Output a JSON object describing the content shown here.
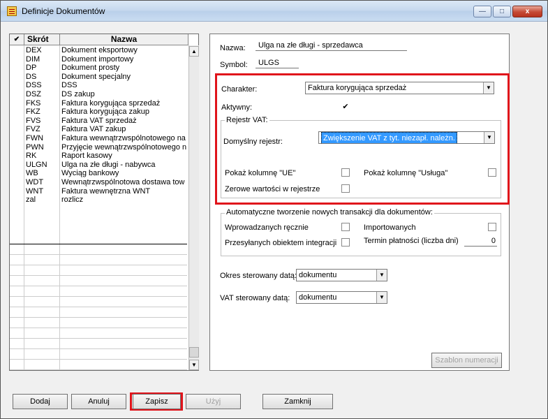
{
  "window": {
    "title": "Definicje Dokumentów",
    "controls": {
      "minimize": "—",
      "maximize": "□",
      "close": "x"
    }
  },
  "grid": {
    "headers": {
      "check": "✔",
      "code": "Skrót",
      "name": "Nazwa"
    },
    "rows": [
      {
        "code": "DEX",
        "name": "Dokument eksportowy"
      },
      {
        "code": "DIM",
        "name": "Dokument importowy"
      },
      {
        "code": "DP",
        "name": "Dokument prosty"
      },
      {
        "code": "DS",
        "name": "Dokument specjalny"
      },
      {
        "code": "DSS",
        "name": "DSS"
      },
      {
        "code": "DSZ",
        "name": "DS zakup"
      },
      {
        "code": "FKS",
        "name": "Faktura korygująca sprzedaż"
      },
      {
        "code": "FKZ",
        "name": "Faktura korygująca zakup"
      },
      {
        "code": "FVS",
        "name": "Faktura VAT sprzedaż"
      },
      {
        "code": "FVZ",
        "name": "Faktura VAT zakup"
      },
      {
        "code": "FWN",
        "name": "Faktura wewnątrzwspólnotowego na"
      },
      {
        "code": "PWN",
        "name": "Przyjęcie wewnątrzwspólnotowego n"
      },
      {
        "code": "RK",
        "name": "Raport kasowy"
      },
      {
        "code": "ULGN",
        "name": "Ulga na złe długi - nabywca"
      },
      {
        "code": "WB",
        "name": "Wyciąg bankowy"
      },
      {
        "code": "WDT",
        "name": "Wewnątrzwspólnotowa dostawa tow"
      },
      {
        "code": "WNT",
        "name": "Faktura wewnętrzna WNT"
      },
      {
        "code": "zal",
        "name": "rozlicz"
      }
    ]
  },
  "form": {
    "name_label": "Nazwa:",
    "name_value": "Ulga na złe długi - sprzedawca",
    "symbol_label": "Symbol:",
    "symbol_value": "ULGS",
    "charakter_label": "Charakter:",
    "charakter_value": "Faktura korygująca sprzedaż",
    "aktywny_label": "Aktywny:",
    "aktywny_checked": "✔",
    "rejestr_group": "Rejestr VAT:",
    "domyslny_label": "Domyślny rejestr:",
    "domyslny_value": "Zwiększenie VAT z tyt. niezapł. należn.",
    "pokaz_ue_label": "Pokaż kolumnę \"UE\"",
    "pokaz_usluga_label": "Pokaż kolumnę \"Usługa\"",
    "zerowe_label": "Zerowe wartości w rejestrze",
    "auto_group": "Automatyczne tworzenie nowych transakcji dla dokumentów:",
    "wprowadzanych_label": "Wprowadzanych ręcznie",
    "importowanych_label": "Importowanych",
    "przesylanych_label": "Przesyłanych obiektem integracji",
    "termin_label": "Termin płatności (liczba dni)",
    "termin_value": "0",
    "okres_label": "Okres sterowany datą:",
    "okres_value": "dokumentu",
    "vat_label": "VAT sterowany datą:",
    "vat_value": "dokumentu",
    "szablon_label": "Szablon numeracji"
  },
  "buttons": {
    "dodaj": "Dodaj",
    "anuluj": "Anuluj",
    "zapisz": "Zapisz",
    "uzyj": "Użyj",
    "zamknij": "Zamknij"
  },
  "colors": {
    "highlight_red": "#e0141b",
    "selection_blue": "#3399ff"
  }
}
